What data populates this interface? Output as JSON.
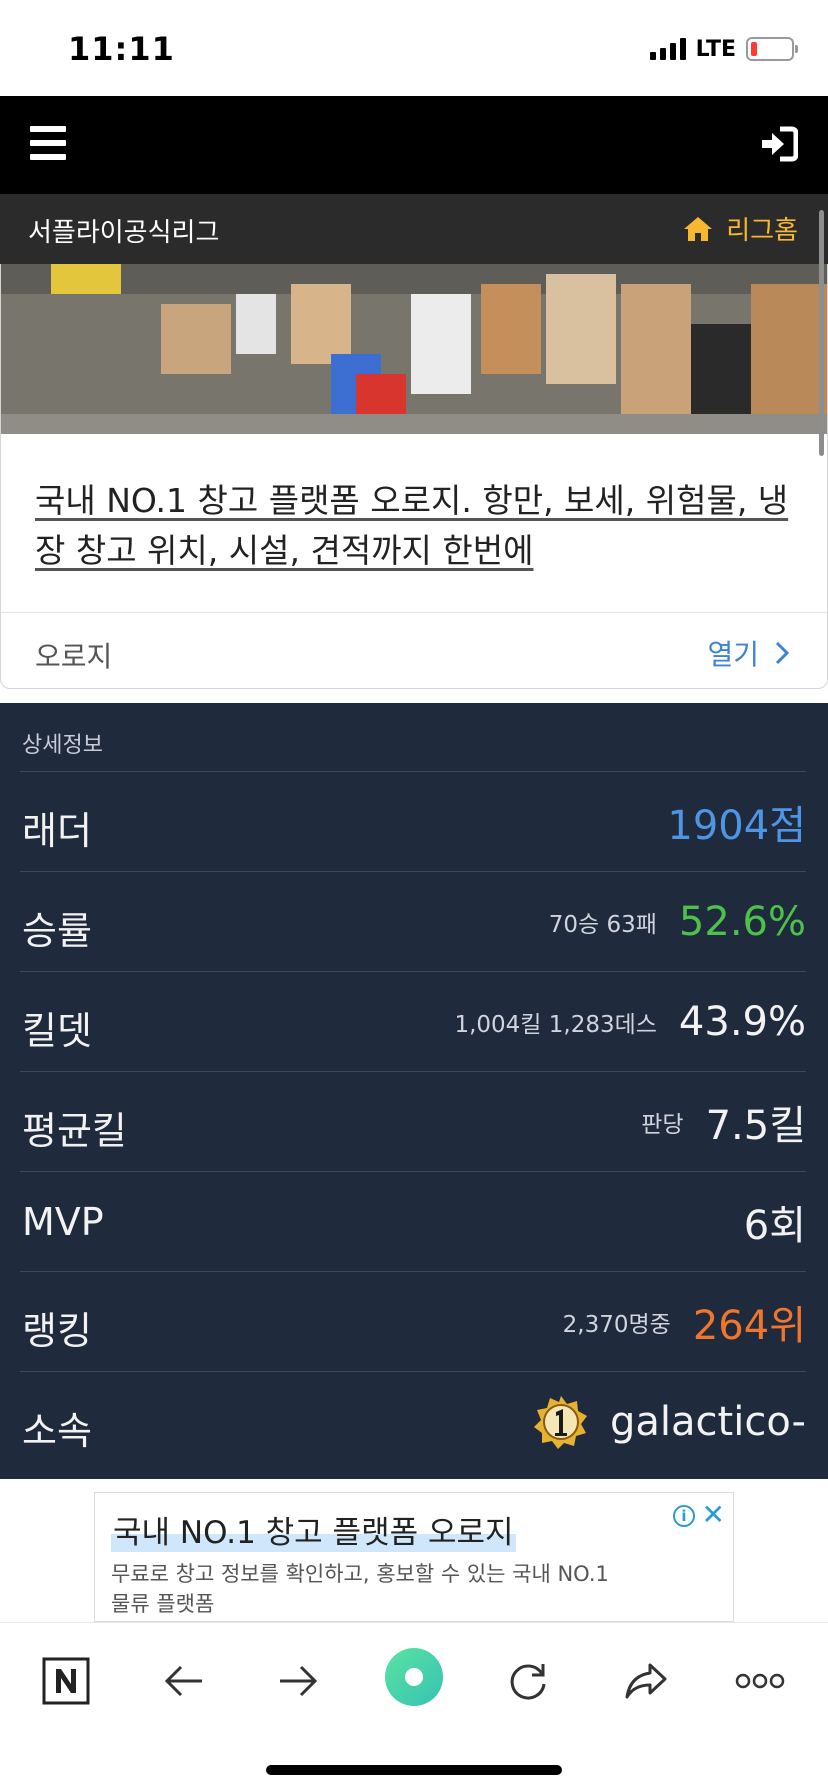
{
  "status_bar": {
    "time": "11:11",
    "network": "LTE"
  },
  "league_bar": {
    "title": "서플라이공식리그",
    "home_label": "리그홈"
  },
  "ad_card": {
    "headline": "국내 NO.1 창고 플랫폼 오로지. 항만, 보세, 위험물, 냉장 창고 위치, 시설, 견적까지 한번에",
    "brand": "오로지",
    "open_label": "열기"
  },
  "detail": {
    "heading": "상세정보",
    "ladder": {
      "label": "래더",
      "value": "1904점"
    },
    "winrate": {
      "label": "승률",
      "sub": "70승 63패",
      "value": "52.6%"
    },
    "killdeath": {
      "label": "킬뎃",
      "sub": "1,004킬 1,283데스",
      "value": "43.9%"
    },
    "avgkill": {
      "label": "평균킬",
      "sub": "판당",
      "value": "7.5킬"
    },
    "mvp": {
      "label": "MVP",
      "value": "6회"
    },
    "ranking": {
      "label": "랭킹",
      "sub": "2,370명중",
      "value": "264위"
    },
    "clan": {
      "label": "소속",
      "value": "galactico-"
    }
  },
  "banner_ad": {
    "title": "국내 NO.1 창고 플랫폼 오로지",
    "description": "무료로 창고 정보를 확인하고, 홍보할 수 있는 국내 NO.1 물류 플랫폼"
  },
  "colors": {
    "ladder": "#4f95e6",
    "winrate": "#4cc24a",
    "ranking": "#f0762d",
    "league_home": "#f5b82e",
    "panel_bg": "#202a3d"
  },
  "icons": [
    "hamburger-menu-icon",
    "login-icon",
    "home-icon",
    "chevron-right-icon",
    "info-icon",
    "close-icon",
    "naver-n-icon",
    "back-arrow-icon",
    "forward-arrow-icon",
    "green-dot-icon",
    "refresh-icon",
    "share-icon",
    "more-icon"
  ]
}
